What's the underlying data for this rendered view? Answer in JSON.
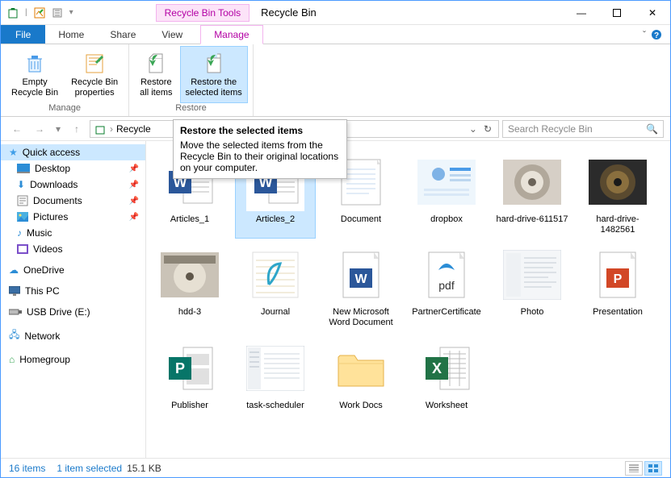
{
  "window": {
    "title": "Recycle Bin",
    "toolsTab": "Recycle Bin Tools"
  },
  "tabs": {
    "file": "File",
    "home": "Home",
    "share": "Share",
    "view": "View",
    "manage": "Manage"
  },
  "ribbon": {
    "manage": {
      "empty": "Empty\nRecycle Bin",
      "props": "Recycle Bin\nproperties",
      "label": "Manage"
    },
    "restore": {
      "all": "Restore\nall items",
      "sel": "Restore the\nselected items",
      "label": "Restore"
    }
  },
  "tooltip": {
    "title": "Restore the selected items",
    "body": "Move the selected items from the Recycle Bin to their original locations on your computer."
  },
  "address": {
    "location": "Recycle"
  },
  "search": {
    "placeholder": "Search Recycle Bin"
  },
  "sidebar": {
    "quick": "Quick access",
    "pinned": {
      "desktop": "Desktop",
      "downloads": "Downloads",
      "documents": "Documents",
      "pictures": "Pictures"
    },
    "music": "Music",
    "videos": "Videos",
    "onedrive": "OneDrive",
    "thispc": "This PC",
    "usb": "USB Drive (E:)",
    "network": "Network",
    "homegroup": "Homegroup"
  },
  "items": {
    "a1": "Articles_1",
    "a2": "Articles_2",
    "doc": "Document",
    "dropbox": "dropbox",
    "hd1": "hard-drive-611517",
    "hd2": "hard-drive-1482561",
    "hdd3": "hdd-3",
    "journal": "Journal",
    "nwd": "New Microsoft Word Document",
    "partner": "PartnerCertificate",
    "photo": "Photo",
    "pres": "Presentation",
    "pub": "Publisher",
    "task": "task-scheduler",
    "work": "Work Docs",
    "ws": "Worksheet"
  },
  "status": {
    "count": "16 items",
    "selected": "1 item selected",
    "size": "15.1 KB"
  }
}
